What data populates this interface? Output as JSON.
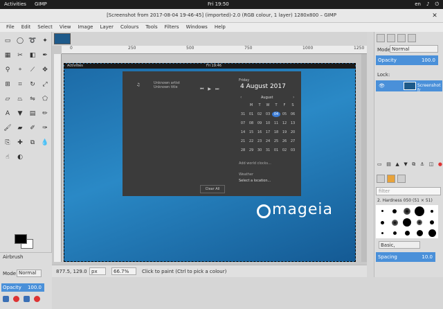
{
  "topbar": {
    "activities": "Activities",
    "app": "GIMP",
    "clock": "Fri 19:50",
    "lang": "en"
  },
  "window": {
    "title": "[Screenshot from 2017-08-04 19-46-45] (imported)-2.0 (RGB colour, 1 layer) 1280x800 – GIMP",
    "close": "✕"
  },
  "menu": [
    "File",
    "Edit",
    "Select",
    "View",
    "Image",
    "Layer",
    "Colours",
    "Tools",
    "Filters",
    "Windows",
    "Help"
  ],
  "ruler": {
    "ticks": [
      "0",
      "250",
      "500",
      "750",
      "1000",
      "1250"
    ]
  },
  "canvas": {
    "inner_activities": "Activities",
    "inner_clock": "Fri 19:46",
    "notification": {
      "artist": "Unknown artist",
      "title": "Unknown title"
    },
    "calendar": {
      "day": "Friday",
      "date": "4 August 2017",
      "month": "August",
      "headers": [
        "",
        "M",
        "T",
        "W",
        "T",
        "F",
        "S"
      ],
      "rows": [
        [
          "31",
          "01",
          "02",
          "03",
          "04",
          "05",
          "06"
        ],
        [
          "07",
          "08",
          "09",
          "10",
          "11",
          "12",
          "13"
        ],
        [
          "14",
          "15",
          "16",
          "17",
          "18",
          "19",
          "20"
        ],
        [
          "21",
          "22",
          "23",
          "24",
          "25",
          "26",
          "27"
        ],
        [
          "28",
          "29",
          "30",
          "31",
          "01",
          "02",
          "03"
        ]
      ],
      "today": "04",
      "world_clocks": "Add world clocks...",
      "weather": "Weather",
      "location": "Select a location..."
    },
    "clear_all": "Clear All",
    "logo": "mageia"
  },
  "toolbox": {
    "tools": [
      "rect-select",
      "ellipse-select",
      "free-select",
      "fuzzy-select",
      "select-by-color",
      "scissors",
      "foreground-select",
      "paths",
      "color-picker",
      "zoom",
      "measure",
      "move",
      "align",
      "crop",
      "rotate",
      "scale",
      "shear",
      "perspective",
      "flip",
      "cage",
      "text",
      "bucket-fill",
      "blend",
      "pencil",
      "paintbrush",
      "eraser",
      "airbrush",
      "ink",
      "clone",
      "heal",
      "perspective-clone",
      "blur",
      "smudge",
      "dodge-burn"
    ],
    "options_title": "Airbrush",
    "mode_label": "Mode:",
    "mode_value": "Normal",
    "opacity_label": "Opacity",
    "opacity_value": "100.0"
  },
  "status": {
    "coords": "877.5, 129.0",
    "unit": "px",
    "zoom": "66.7%",
    "hint": "Click to paint (Ctrl to pick a colour)"
  },
  "layers": {
    "mode_label": "Mode:",
    "mode_value": "Normal",
    "opacity_label": "Opacity",
    "opacity_value": "100.0",
    "lock_label": "Lock:",
    "layer_name": "Screenshot fr"
  },
  "brushes": {
    "filter_placeholder": "filter",
    "brush_name": "2. Hardness 050 (51 × 51)",
    "preset": "Basic,",
    "spacing_label": "Spacing",
    "spacing_value": "10.0"
  }
}
